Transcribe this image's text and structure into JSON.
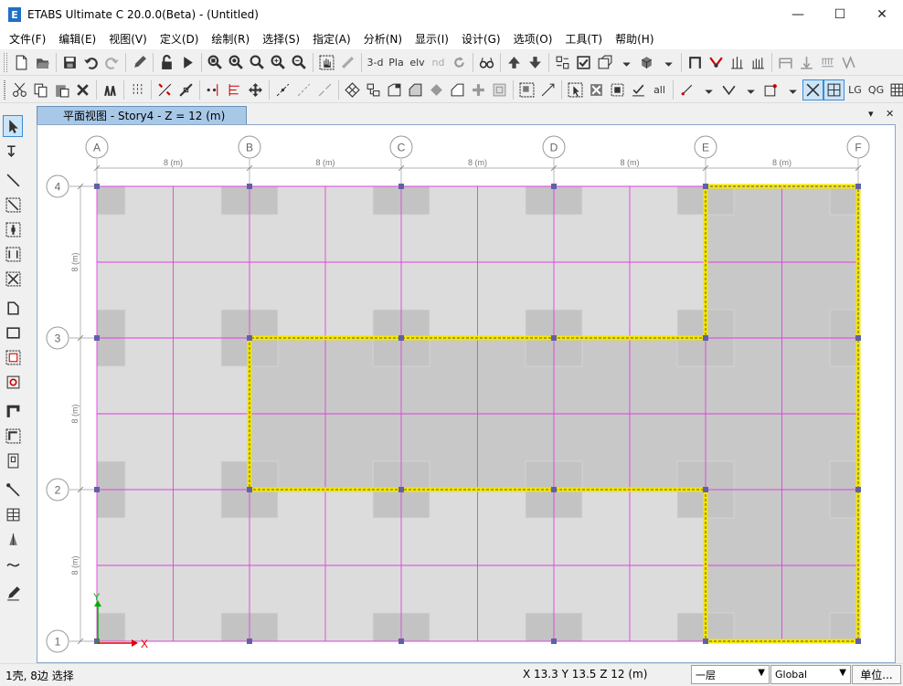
{
  "app": {
    "logo_letter": "E",
    "title": "ETABS Ultimate C 20.0.0(Beta) - (Untitled)",
    "window_controls": {
      "minimize": "—",
      "maximize": "☐",
      "close": "✕"
    }
  },
  "menu": [
    "文件(F)",
    "编辑(E)",
    "视图(V)",
    "定义(D)",
    "绘制(R)",
    "选择(S)",
    "指定(A)",
    "分析(N)",
    "显示(I)",
    "设计(G)",
    "选项(O)",
    "工具(T)",
    "帮助(H)"
  ],
  "toolbar": {
    "view_3d": "3-d",
    "view_plan": "Pla",
    "view_elev": "elv",
    "view_nd": "nd",
    "lg": "LG",
    "qg": "QG",
    "all": "all"
  },
  "document": {
    "tab_title": "平面视图 - Story4 - Z = 12 (m)",
    "tab_menu_glyph": "▾",
    "tab_close_glyph": "✕"
  },
  "plan": {
    "x_grids": [
      "A",
      "B",
      "C",
      "D",
      "E",
      "F"
    ],
    "y_grids": [
      "4",
      "3",
      "2",
      "1"
    ],
    "x_spacings": [
      "8 (m)",
      "8 (m)",
      "8 (m)",
      "8 (m)",
      "8 (m)"
    ],
    "y_spacings": [
      "8 (m)",
      "8 (m)",
      "8 (m)"
    ],
    "axis_x": "X",
    "axis_y": "Y",
    "colors": {
      "slab": "#dcdcdc",
      "selected_slab": "#c8c8c8",
      "column": "#c3c3c3",
      "grid_line": "#e040e0",
      "selection": "#f5e600",
      "node": "#6060a8",
      "axis_x": "#e00000",
      "axis_y": "#00b000"
    }
  },
  "status": {
    "selection": "1壳, 8边 选择",
    "coords": "X 13.3  Y 13.5  Z 12 (m)",
    "story": "一层",
    "coord_system": "Global",
    "units_button": "单位..."
  }
}
